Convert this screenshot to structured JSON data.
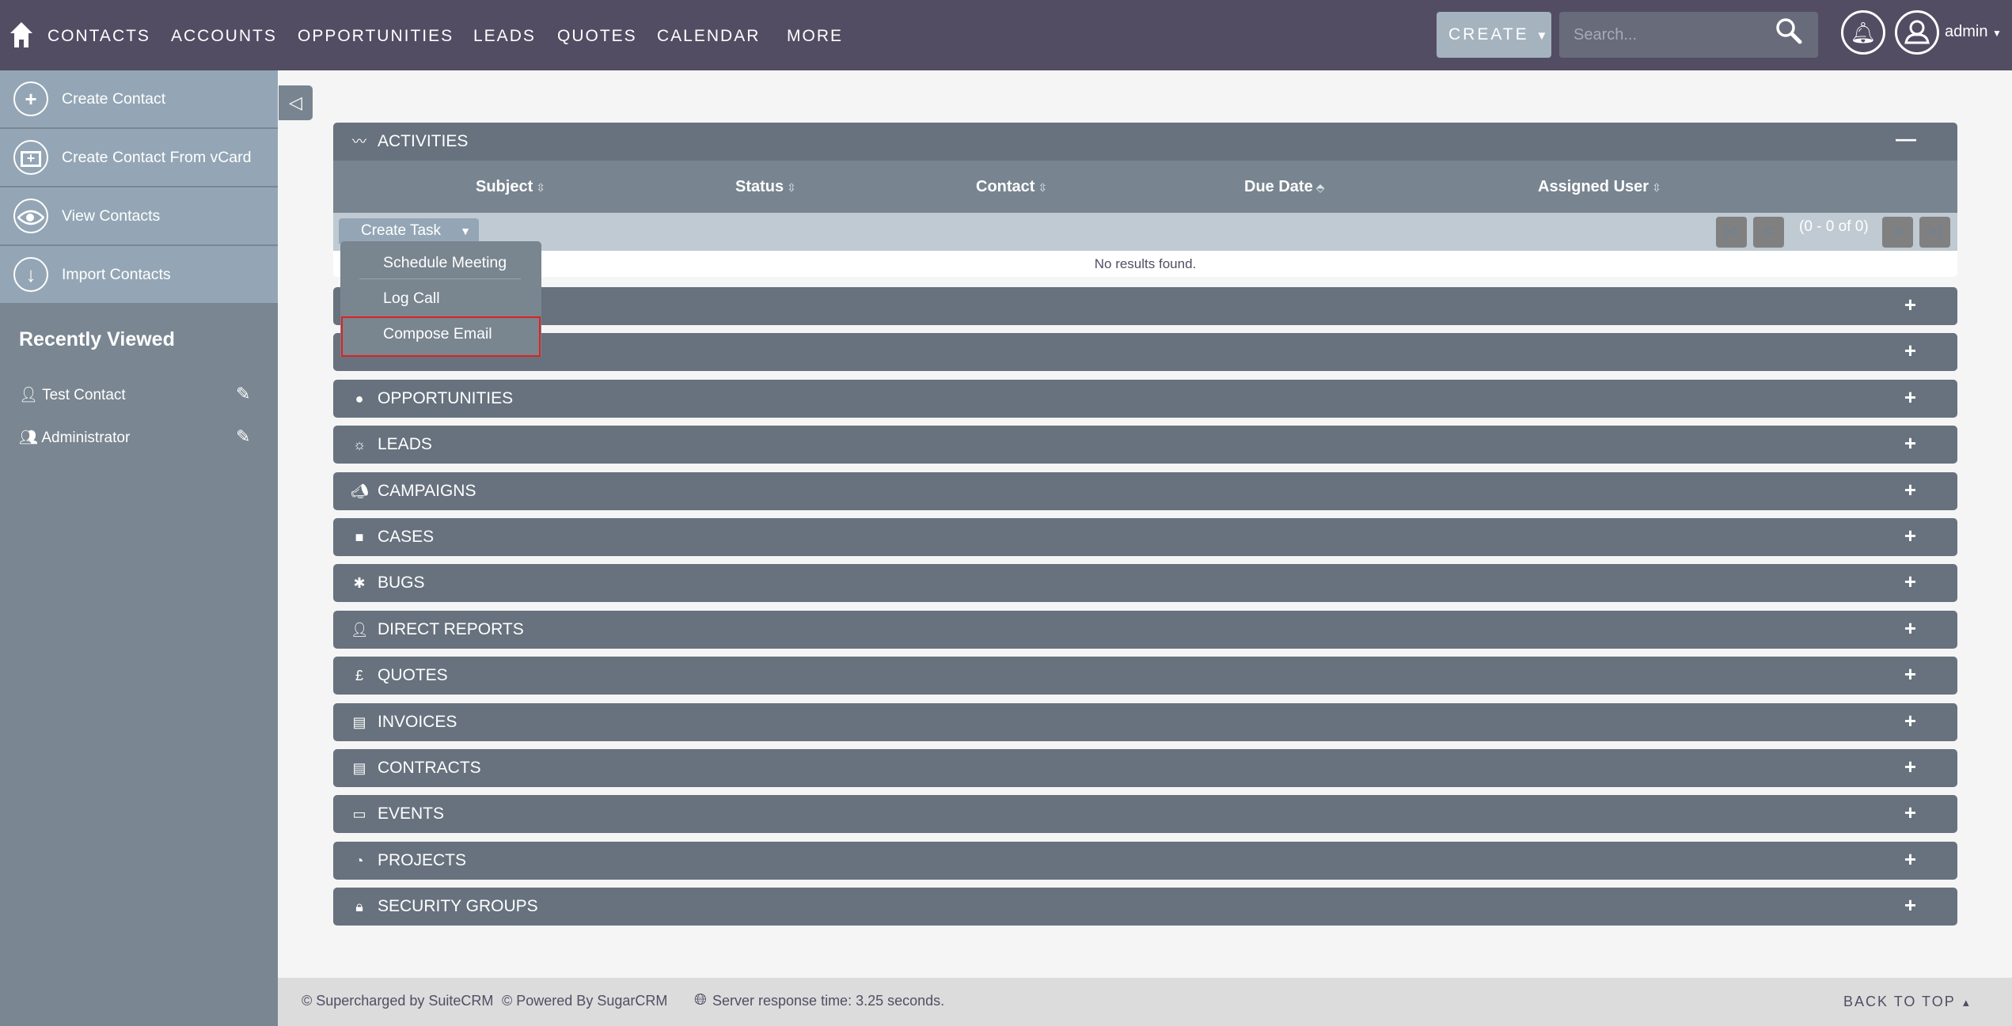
{
  "nav": {
    "items": [
      "CONTACTS",
      "ACCOUNTS",
      "OPPORTUNITIES",
      "LEADS",
      "QUOTES",
      "CALENDAR",
      "MORE"
    ],
    "create_label": "CREATE",
    "search_placeholder": "Search...",
    "user": "admin"
  },
  "sidebar": {
    "actions": [
      {
        "label": "Create Contact",
        "icon": "plus-circle-icon"
      },
      {
        "label": "Create Contact From vCard",
        "icon": "vcard-icon"
      },
      {
        "label": "View Contacts",
        "icon": "eye-icon"
      },
      {
        "label": "Import Contacts",
        "icon": "download-icon"
      }
    ],
    "recently_viewed_title": "Recently Viewed",
    "recent": [
      {
        "label": "Test Contact",
        "icon": "person-icon"
      },
      {
        "label": "Administrator",
        "icon": "users-icon"
      }
    ]
  },
  "activities": {
    "title": "ACTIVITIES",
    "columns": [
      "Subject",
      "Status",
      "Contact",
      "Due Date",
      "Assigned User"
    ],
    "create_task": "Create Task",
    "pagination": "(0 - 0 of 0)",
    "empty": "No results found.",
    "dropdown": [
      "Schedule Meeting",
      "Log Call",
      "Compose Email"
    ],
    "highlight_color": "#e02020"
  },
  "panels": [
    "",
    "",
    "OPPORTUNITIES",
    "LEADS",
    "CAMPAIGNS",
    "CASES",
    "BUGS",
    "DIRECT REPORTS",
    "QUOTES",
    "INVOICES",
    "CONTRACTS",
    "EVENTS",
    "PROJECTS",
    "SECURITY GROUPS"
  ],
  "footer": {
    "suitecrm": "© Supercharged by SuiteCRM",
    "sugarcrm": "© Powered By SugarCRM",
    "server": "Server response time: 3.25 seconds.",
    "back_to_top": "BACK TO TOP"
  },
  "colors": {
    "header": "#534d64",
    "panel": "#67727e",
    "sidebar": "#94a6b5"
  }
}
